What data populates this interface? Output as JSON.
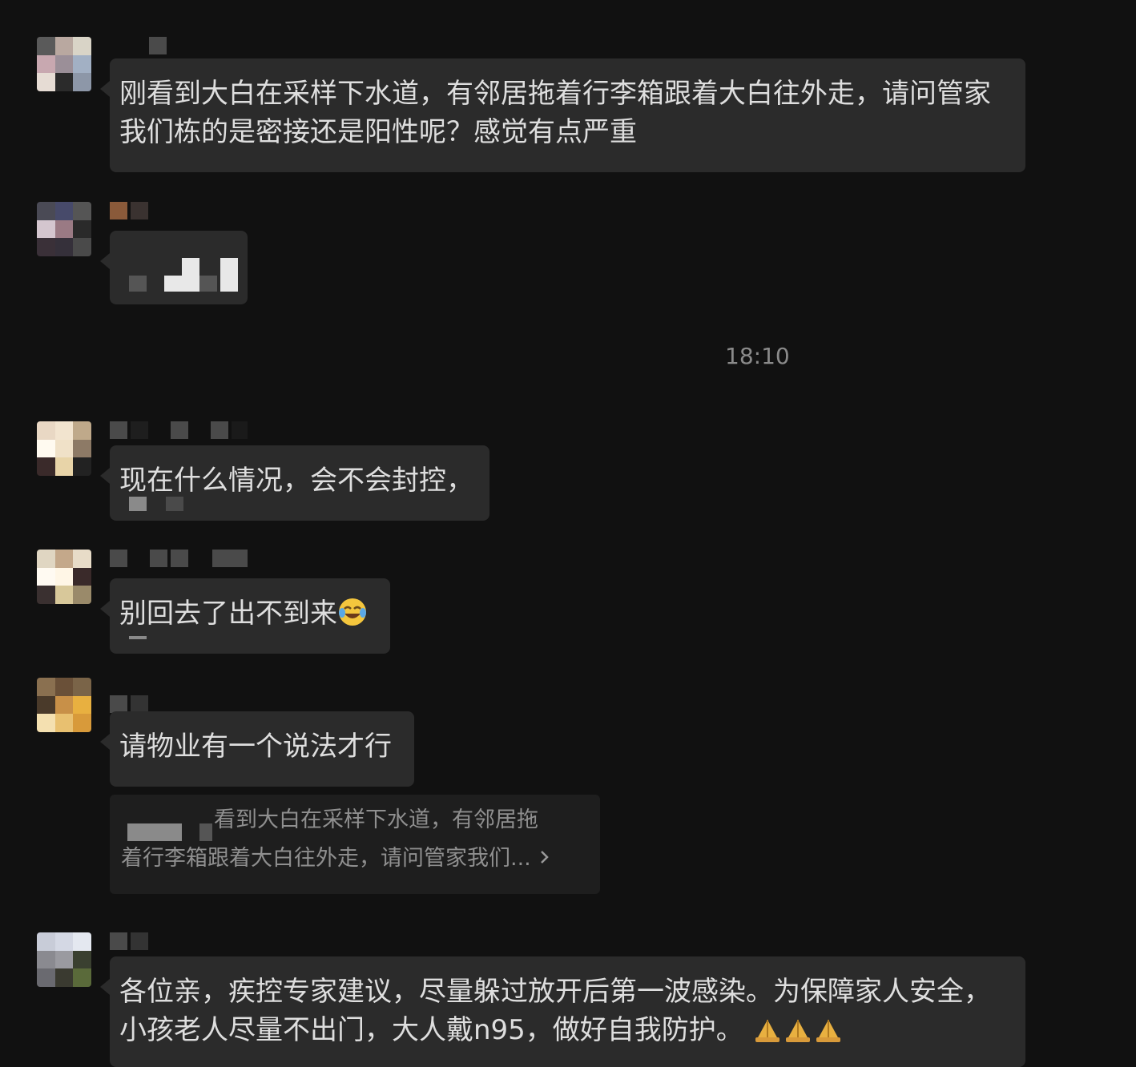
{
  "chat": {
    "messages": [
      {
        "text": "刚看到大白在采样下水道，有邻居拖着行李箱跟着大白往外走，请问管家我们栋的是密接还是阳性呢？感觉有点严重"
      },
      {
        "text": ""
      },
      {
        "text": "现在什么情况，会不会封控，"
      },
      {
        "text": "别回去了出不到来"
      },
      {
        "text": "请物业有一个说法才行",
        "quote": "看到大白在采样下水道，有邻居拖着行李箱跟着大白往外走，请问管家我们..."
      },
      {
        "text": "各位亲，疾控专家建议，尽量躲过放开后第一波感染。为保障家人安全，小孩老人尽量不出门，大人戴n95，做好自我防护。"
      }
    ],
    "timestamp": "18:10",
    "quote_line1": "看到大白在采样下水道，有邻居拖",
    "quote_line2": "着行李箱跟着大白往外走，请问管家我们...",
    "message1_line1": "刚看到大白在采样下水道，有邻居拖着行李箱跟着大白往外走，请问管家",
    "message1_line2": "我们栋的是密接还是阳性呢？感觉有点严重",
    "message6_line1": "各位亲，疾控专家建议，尽量躲过放开后第一波感染。为保障家人安全，",
    "message6_line2": "小孩老人尽量不出门，大人戴n95，做好自我防护。",
    "icons": {
      "crying_laughing": "face-with-tears-of-joy-icon",
      "folded_hands": "folded-hands-icon",
      "chevron": "chevron-right-icon"
    }
  }
}
